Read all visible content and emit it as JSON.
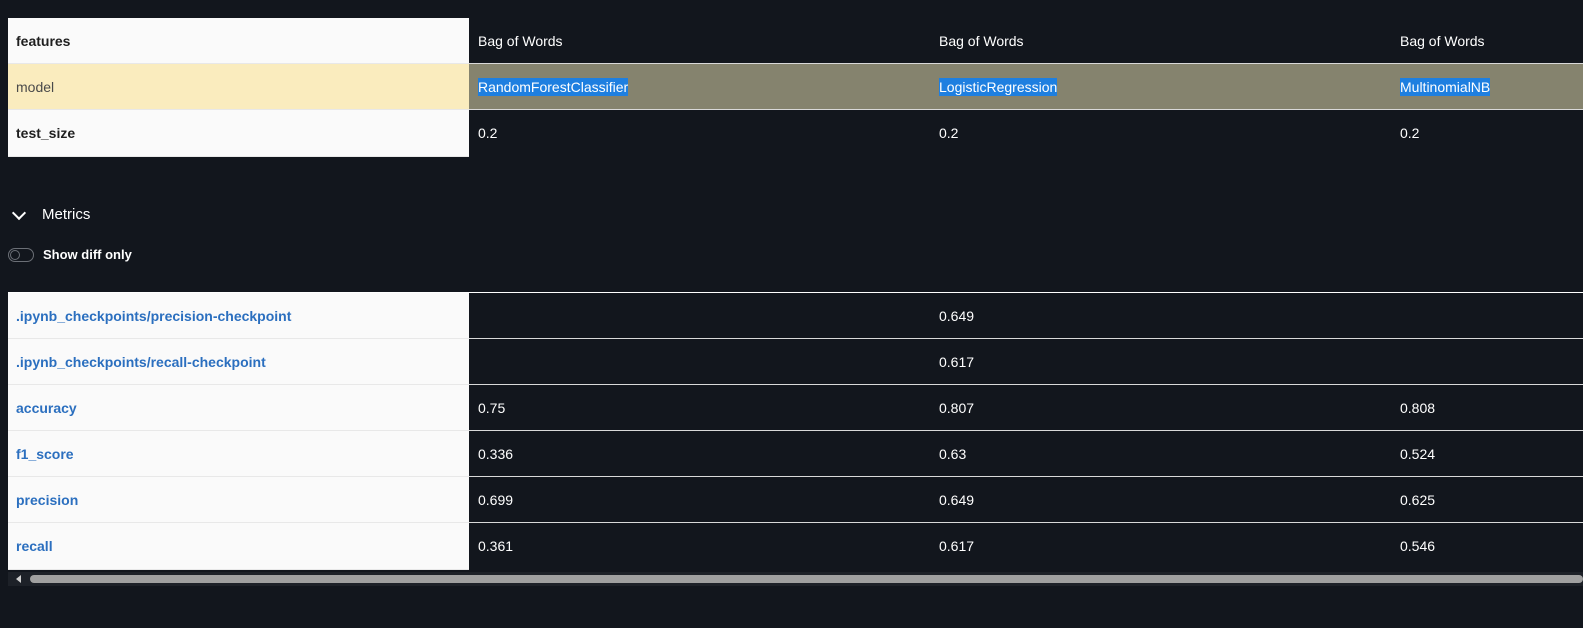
{
  "params": {
    "rows": [
      {
        "label": "features",
        "values": [
          "Bag of Words",
          "Bag of Words",
          "Bag of Words"
        ]
      },
      {
        "label": "model",
        "values": [
          "RandomForestClassifier",
          "LogisticRegression",
          "MultinomialNB"
        ]
      },
      {
        "label": "test_size",
        "values": [
          "0.2",
          "0.2",
          "0.2"
        ]
      }
    ]
  },
  "metrics_section": {
    "title": "Metrics",
    "toggle_label": "Show diff only",
    "toggle_on": false
  },
  "metrics": {
    "rows": [
      {
        "label": ".ipynb_checkpoints/precision-checkpoint",
        "values": [
          "",
          "0.649",
          ""
        ]
      },
      {
        "label": ".ipynb_checkpoints/recall-checkpoint",
        "values": [
          "",
          "0.617",
          ""
        ]
      },
      {
        "label": "accuracy",
        "values": [
          "0.75",
          "0.807",
          "0.808"
        ]
      },
      {
        "label": "f1_score",
        "values": [
          "0.336",
          "0.63",
          "0.524"
        ]
      },
      {
        "label": "precision",
        "values": [
          "0.699",
          "0.649",
          "0.625"
        ]
      },
      {
        "label": "recall",
        "values": [
          "0.361",
          "0.617",
          "0.546"
        ]
      }
    ]
  },
  "colors": {
    "background": "#12161d",
    "highlight_row": "#85836e",
    "highlight_label": "#faecbe",
    "selection": "#1e7fe0",
    "metric_link": "#2b6fbf"
  }
}
